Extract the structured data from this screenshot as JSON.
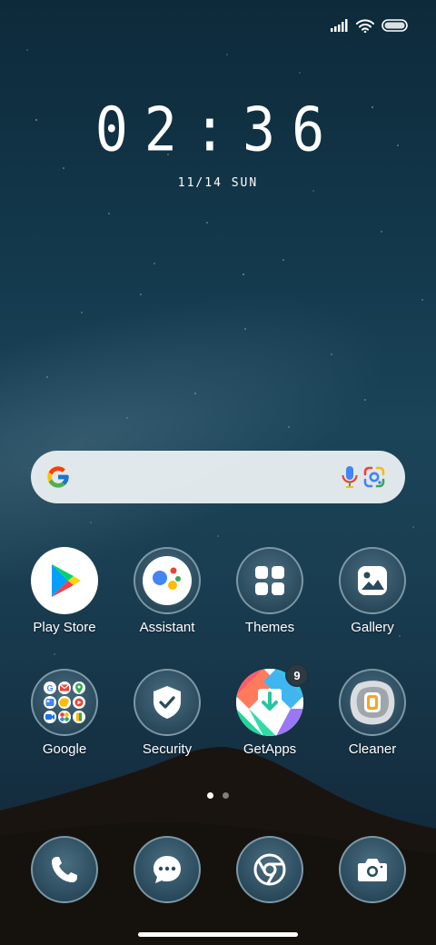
{
  "status_bar": {
    "icons": [
      "signal-icon",
      "wifi-icon",
      "battery-icon"
    ]
  },
  "clock": {
    "time": "02:36",
    "date": "11/14 SUN"
  },
  "search": {
    "icons": [
      "google-g-icon",
      "microphone-icon",
      "google-lens-icon"
    ]
  },
  "apps_row1": [
    {
      "label": "Play Store",
      "icon": "play-store-icon"
    },
    {
      "label": "Assistant",
      "icon": "assistant-icon"
    },
    {
      "label": "Themes",
      "icon": "themes-icon"
    },
    {
      "label": "Gallery",
      "icon": "gallery-icon"
    }
  ],
  "apps_row2": [
    {
      "label": "Google",
      "icon": "google-folder-icon"
    },
    {
      "label": "Security",
      "icon": "shield-check-icon"
    },
    {
      "label": "GetApps",
      "icon": "getapps-icon",
      "badge": "9"
    },
    {
      "label": "Cleaner",
      "icon": "cleaner-icon"
    }
  ],
  "page_indicator": {
    "pages": 2,
    "current": 1
  },
  "dock": [
    {
      "name": "phone",
      "icon": "phone-icon"
    },
    {
      "name": "messages",
      "icon": "message-icon"
    },
    {
      "name": "chrome",
      "icon": "chrome-icon"
    },
    {
      "name": "camera",
      "icon": "camera-icon"
    }
  ],
  "colors": {
    "accent": "#ffffff",
    "wallpaper_top": "#0d2a3a",
    "wallpaper_bottom": "#0f2331"
  }
}
